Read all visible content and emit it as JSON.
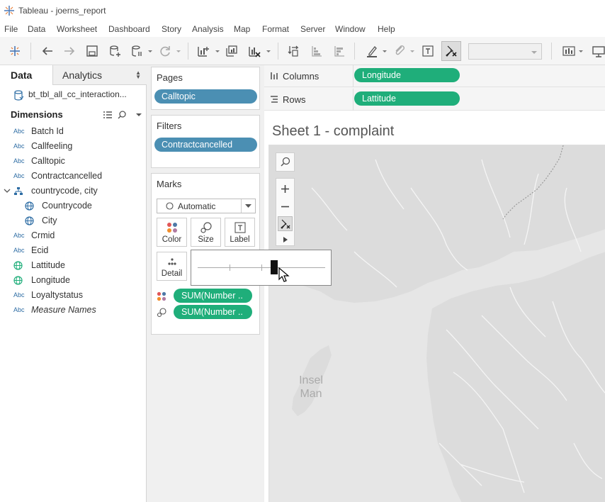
{
  "window": {
    "title": "Tableau - joerns_report"
  },
  "menu": [
    "File",
    "Data",
    "Worksheet",
    "Dashboard",
    "Story",
    "Analysis",
    "Map",
    "Format",
    "Server",
    "Window",
    "Help"
  ],
  "data_pane": {
    "tabs": {
      "data": "Data",
      "analytics": "Analytics"
    },
    "datasource": "bt_tbl_all_cc_interaction...",
    "dimensions_header": "Dimensions",
    "dimensions": [
      {
        "type": "Abc",
        "name": "Batch Id"
      },
      {
        "type": "Abc",
        "name": "Callfeeling"
      },
      {
        "type": "Abc",
        "name": "Calltopic"
      },
      {
        "type": "Abc",
        "name": "Contractcancelled"
      },
      {
        "type": "hierarchy",
        "name": "countrycode, city"
      },
      {
        "type": "globe",
        "name": "Countrycode"
      },
      {
        "type": "globe",
        "name": "City"
      },
      {
        "type": "Abc",
        "name": "Crmid"
      },
      {
        "type": "Abc",
        "name": "Ecid"
      },
      {
        "type": "globe",
        "name": "Lattitude"
      },
      {
        "type": "globe",
        "name": "Longitude"
      },
      {
        "type": "Abc",
        "name": "Loyaltystatus"
      },
      {
        "type": "Abc",
        "name": "Measure Names"
      }
    ]
  },
  "pages": {
    "title": "Pages",
    "pill": "Calltopic"
  },
  "filters": {
    "title": "Filters",
    "pill": "Contractcancelled"
  },
  "marks": {
    "title": "Marks",
    "type": "Automatic",
    "buttons": {
      "color": "Color",
      "size": "Size",
      "label": "Label",
      "detail": "Detail"
    },
    "pills": [
      "SUM(Number ..",
      "SUM(Number .."
    ]
  },
  "shelves": {
    "columns_label": "Columns",
    "columns_pill": "Longitude",
    "rows_label": "Rows",
    "rows_pill": "Lattitude"
  },
  "sheet": {
    "title": "Sheet 1 - complaint"
  },
  "map": {
    "label": "Insel\nMan",
    "label_line1": "Insel",
    "label_line2": "Man",
    "zoom_level": 0.6
  },
  "colors": {
    "green_pill": "#1fae7a",
    "blue_pill": "#4b8fb3"
  }
}
